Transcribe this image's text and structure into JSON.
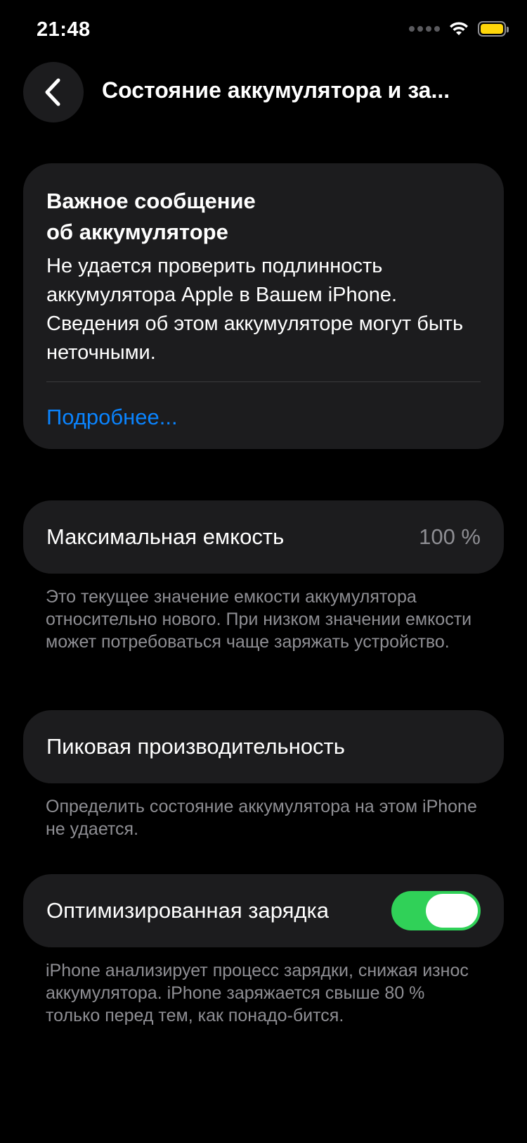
{
  "status_bar": {
    "time": "21:48",
    "icons": [
      "cellular-signal-icon",
      "wifi-icon",
      "battery-icon"
    ],
    "battery_color": "#ffd60a"
  },
  "nav": {
    "back_icon": "chevron-left-icon",
    "title": "Состояние аккумулятора и за..."
  },
  "alert": {
    "title_line1": "Важное сообщение",
    "title_line2": "об аккумуляторе",
    "body": "Не удается проверить подлинность аккумулятора Apple в Вашем iPhone. Сведения об этом аккумуляторе могут быть неточными.",
    "link": "Подробнее...",
    "link_color": "#0a84ff"
  },
  "max_capacity": {
    "label": "Максимальная емкость",
    "value": "100 %",
    "footnote": "Это текущее значение емкости аккумулятора относительно нового. При низком значении емкости может потребоваться чаще заряжать устройство."
  },
  "peak_performance": {
    "label": "Пиковая производительность",
    "footnote": "Определить состояние аккумулятора на этом iPhone не удается."
  },
  "optimized_charging": {
    "label": "Оптимизированная зарядка",
    "enabled": true,
    "toggle_color": "#30d158",
    "footnote": "iPhone анализирует процесс зарядки, снижая износ аккумулятора. iPhone заряжается свыше 80 % только перед тем, как понадо-бится."
  },
  "colors": {
    "background": "#000000",
    "card": "#1c1c1e",
    "secondary_text": "#8e8e93"
  }
}
